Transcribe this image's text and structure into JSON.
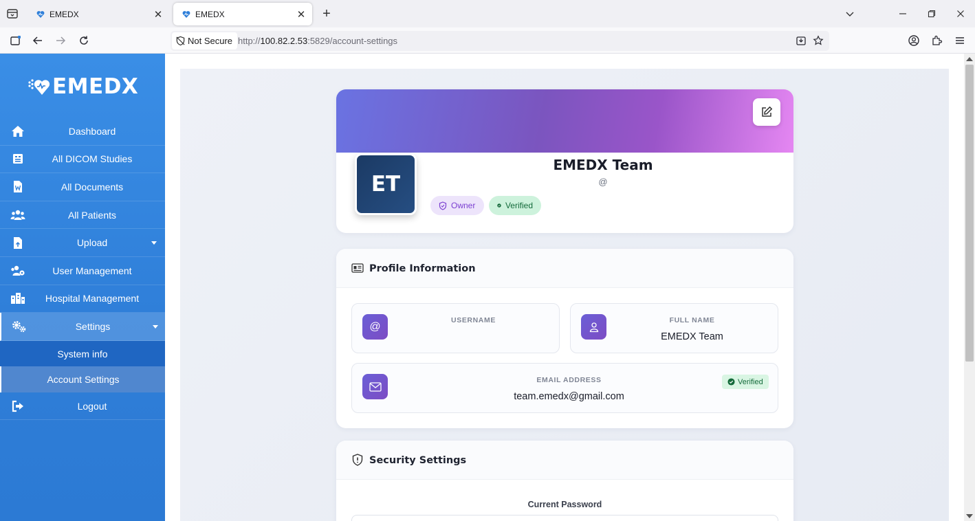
{
  "browser": {
    "tabs": [
      {
        "title": "EMEDX",
        "active": false
      },
      {
        "title": "EMEDX",
        "active": true
      }
    ],
    "security_label": "Not Secure",
    "url_prefix": "http://",
    "url_host": "100.82.2.53",
    "url_rest": ":5829/account-settings"
  },
  "sidebar": {
    "brand": "EMEDX",
    "items": [
      {
        "label": "Dashboard",
        "icon": "home-icon"
      },
      {
        "label": "All DICOM Studies",
        "icon": "dicom-icon"
      },
      {
        "label": "All Documents",
        "icon": "document-icon"
      },
      {
        "label": "All Patients",
        "icon": "patients-icon"
      },
      {
        "label": "Upload",
        "icon": "upload-icon",
        "expandable": true
      },
      {
        "label": "User Management",
        "icon": "user-management-icon"
      },
      {
        "label": "Hospital Management",
        "icon": "hospital-icon"
      },
      {
        "label": "Settings",
        "icon": "settings-icon",
        "expandable": true,
        "active": true
      }
    ],
    "settings_submenu": [
      {
        "label": "System info",
        "active": false
      },
      {
        "label": "Account Settings",
        "active": true
      }
    ],
    "logout": {
      "label": "Logout",
      "icon": "logout-icon"
    }
  },
  "profile": {
    "initials": "ET",
    "name": "EMEDX Team",
    "handle": "@",
    "badges": {
      "owner": "Owner",
      "verified": "Verified"
    }
  },
  "profile_info": {
    "title": "Profile Information",
    "username": {
      "label": "USERNAME",
      "value": ""
    },
    "full_name": {
      "label": "FULL NAME",
      "value": "EMEDX Team"
    },
    "email": {
      "label": "EMAIL ADDRESS",
      "value": "team.emedx@gmail.com",
      "status": "Verified"
    }
  },
  "security": {
    "title": "Security Settings",
    "current_password_label": "Current Password"
  },
  "colors": {
    "sidebar": "#2f7fd9",
    "accent_purple": "#7b55bf",
    "verified_green": "#136a3a"
  }
}
